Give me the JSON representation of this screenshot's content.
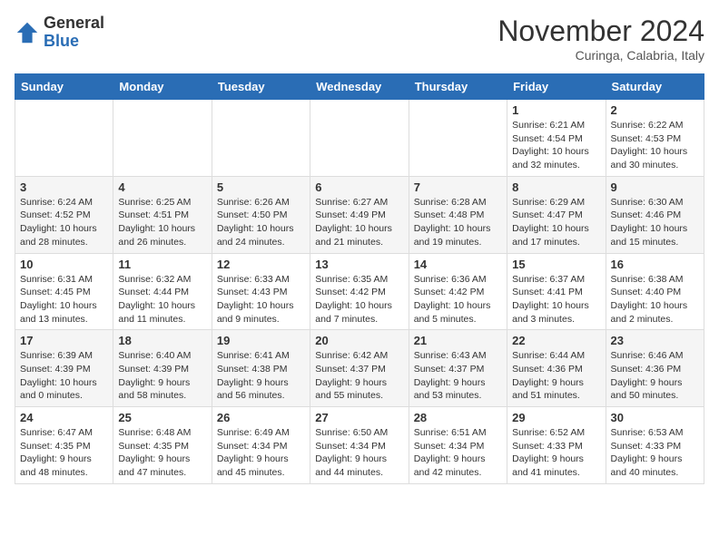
{
  "header": {
    "logo_general": "General",
    "logo_blue": "Blue",
    "month_title": "November 2024",
    "location": "Curinga, Calabria, Italy"
  },
  "weekdays": [
    "Sunday",
    "Monday",
    "Tuesday",
    "Wednesday",
    "Thursday",
    "Friday",
    "Saturday"
  ],
  "weeks": [
    [
      {
        "day": "",
        "info": ""
      },
      {
        "day": "",
        "info": ""
      },
      {
        "day": "",
        "info": ""
      },
      {
        "day": "",
        "info": ""
      },
      {
        "day": "",
        "info": ""
      },
      {
        "day": "1",
        "info": "Sunrise: 6:21 AM\nSunset: 4:54 PM\nDaylight: 10 hours\nand 32 minutes."
      },
      {
        "day": "2",
        "info": "Sunrise: 6:22 AM\nSunset: 4:53 PM\nDaylight: 10 hours\nand 30 minutes."
      }
    ],
    [
      {
        "day": "3",
        "info": "Sunrise: 6:24 AM\nSunset: 4:52 PM\nDaylight: 10 hours\nand 28 minutes."
      },
      {
        "day": "4",
        "info": "Sunrise: 6:25 AM\nSunset: 4:51 PM\nDaylight: 10 hours\nand 26 minutes."
      },
      {
        "day": "5",
        "info": "Sunrise: 6:26 AM\nSunset: 4:50 PM\nDaylight: 10 hours\nand 24 minutes."
      },
      {
        "day": "6",
        "info": "Sunrise: 6:27 AM\nSunset: 4:49 PM\nDaylight: 10 hours\nand 21 minutes."
      },
      {
        "day": "7",
        "info": "Sunrise: 6:28 AM\nSunset: 4:48 PM\nDaylight: 10 hours\nand 19 minutes."
      },
      {
        "day": "8",
        "info": "Sunrise: 6:29 AM\nSunset: 4:47 PM\nDaylight: 10 hours\nand 17 minutes."
      },
      {
        "day": "9",
        "info": "Sunrise: 6:30 AM\nSunset: 4:46 PM\nDaylight: 10 hours\nand 15 minutes."
      }
    ],
    [
      {
        "day": "10",
        "info": "Sunrise: 6:31 AM\nSunset: 4:45 PM\nDaylight: 10 hours\nand 13 minutes."
      },
      {
        "day": "11",
        "info": "Sunrise: 6:32 AM\nSunset: 4:44 PM\nDaylight: 10 hours\nand 11 minutes."
      },
      {
        "day": "12",
        "info": "Sunrise: 6:33 AM\nSunset: 4:43 PM\nDaylight: 10 hours\nand 9 minutes."
      },
      {
        "day": "13",
        "info": "Sunrise: 6:35 AM\nSunset: 4:42 PM\nDaylight: 10 hours\nand 7 minutes."
      },
      {
        "day": "14",
        "info": "Sunrise: 6:36 AM\nSunset: 4:42 PM\nDaylight: 10 hours\nand 5 minutes."
      },
      {
        "day": "15",
        "info": "Sunrise: 6:37 AM\nSunset: 4:41 PM\nDaylight: 10 hours\nand 3 minutes."
      },
      {
        "day": "16",
        "info": "Sunrise: 6:38 AM\nSunset: 4:40 PM\nDaylight: 10 hours\nand 2 minutes."
      }
    ],
    [
      {
        "day": "17",
        "info": "Sunrise: 6:39 AM\nSunset: 4:39 PM\nDaylight: 10 hours\nand 0 minutes."
      },
      {
        "day": "18",
        "info": "Sunrise: 6:40 AM\nSunset: 4:39 PM\nDaylight: 9 hours\nand 58 minutes."
      },
      {
        "day": "19",
        "info": "Sunrise: 6:41 AM\nSunset: 4:38 PM\nDaylight: 9 hours\nand 56 minutes."
      },
      {
        "day": "20",
        "info": "Sunrise: 6:42 AM\nSunset: 4:37 PM\nDaylight: 9 hours\nand 55 minutes."
      },
      {
        "day": "21",
        "info": "Sunrise: 6:43 AM\nSunset: 4:37 PM\nDaylight: 9 hours\nand 53 minutes."
      },
      {
        "day": "22",
        "info": "Sunrise: 6:44 AM\nSunset: 4:36 PM\nDaylight: 9 hours\nand 51 minutes."
      },
      {
        "day": "23",
        "info": "Sunrise: 6:46 AM\nSunset: 4:36 PM\nDaylight: 9 hours\nand 50 minutes."
      }
    ],
    [
      {
        "day": "24",
        "info": "Sunrise: 6:47 AM\nSunset: 4:35 PM\nDaylight: 9 hours\nand 48 minutes."
      },
      {
        "day": "25",
        "info": "Sunrise: 6:48 AM\nSunset: 4:35 PM\nDaylight: 9 hours\nand 47 minutes."
      },
      {
        "day": "26",
        "info": "Sunrise: 6:49 AM\nSunset: 4:34 PM\nDaylight: 9 hours\nand 45 minutes."
      },
      {
        "day": "27",
        "info": "Sunrise: 6:50 AM\nSunset: 4:34 PM\nDaylight: 9 hours\nand 44 minutes."
      },
      {
        "day": "28",
        "info": "Sunrise: 6:51 AM\nSunset: 4:34 PM\nDaylight: 9 hours\nand 42 minutes."
      },
      {
        "day": "29",
        "info": "Sunrise: 6:52 AM\nSunset: 4:33 PM\nDaylight: 9 hours\nand 41 minutes."
      },
      {
        "day": "30",
        "info": "Sunrise: 6:53 AM\nSunset: 4:33 PM\nDaylight: 9 hours\nand 40 minutes."
      }
    ]
  ]
}
